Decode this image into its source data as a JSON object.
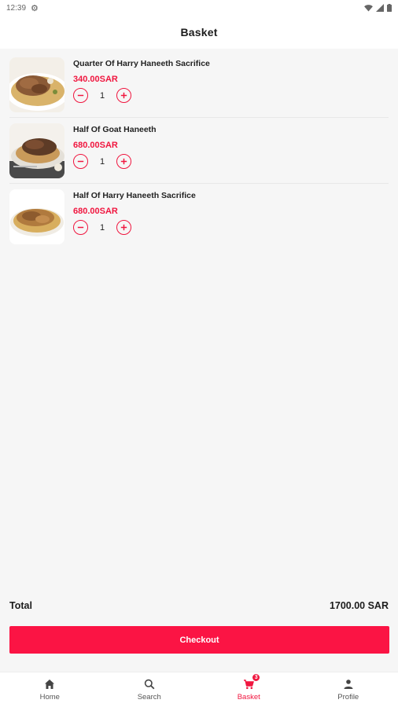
{
  "status_bar": {
    "time": "12:39"
  },
  "app_bar": {
    "title": "Basket"
  },
  "colors": {
    "accent": "#f0163f",
    "checkout_bg": "#fb1444",
    "background": "#f6f6f6"
  },
  "items": [
    {
      "name": "Quarter Of Harry Haneeth Sacrifice",
      "price": "340.00SAR",
      "quantity": "1",
      "image": "dish-rice-meat-plate"
    },
    {
      "name": "Half Of Goat Haneeth",
      "price": "680.00SAR",
      "quantity": "1",
      "image": "dish-goat-meat-tray"
    },
    {
      "name": "Half Of Harry Haneeth Sacrifice",
      "price": "680.00SAR",
      "quantity": "1",
      "image": "dish-meat-rice-bowl"
    }
  ],
  "summary": {
    "total_label": "Total",
    "total_value": "1700.00 SAR"
  },
  "checkout": {
    "label": "Checkout"
  },
  "nav": [
    {
      "label": "Home",
      "icon": "home-icon"
    },
    {
      "label": "Search",
      "icon": "search-icon"
    },
    {
      "label": "Basket",
      "icon": "cart-icon",
      "badge": "3",
      "active": true
    },
    {
      "label": "Profile",
      "icon": "person-icon"
    }
  ]
}
